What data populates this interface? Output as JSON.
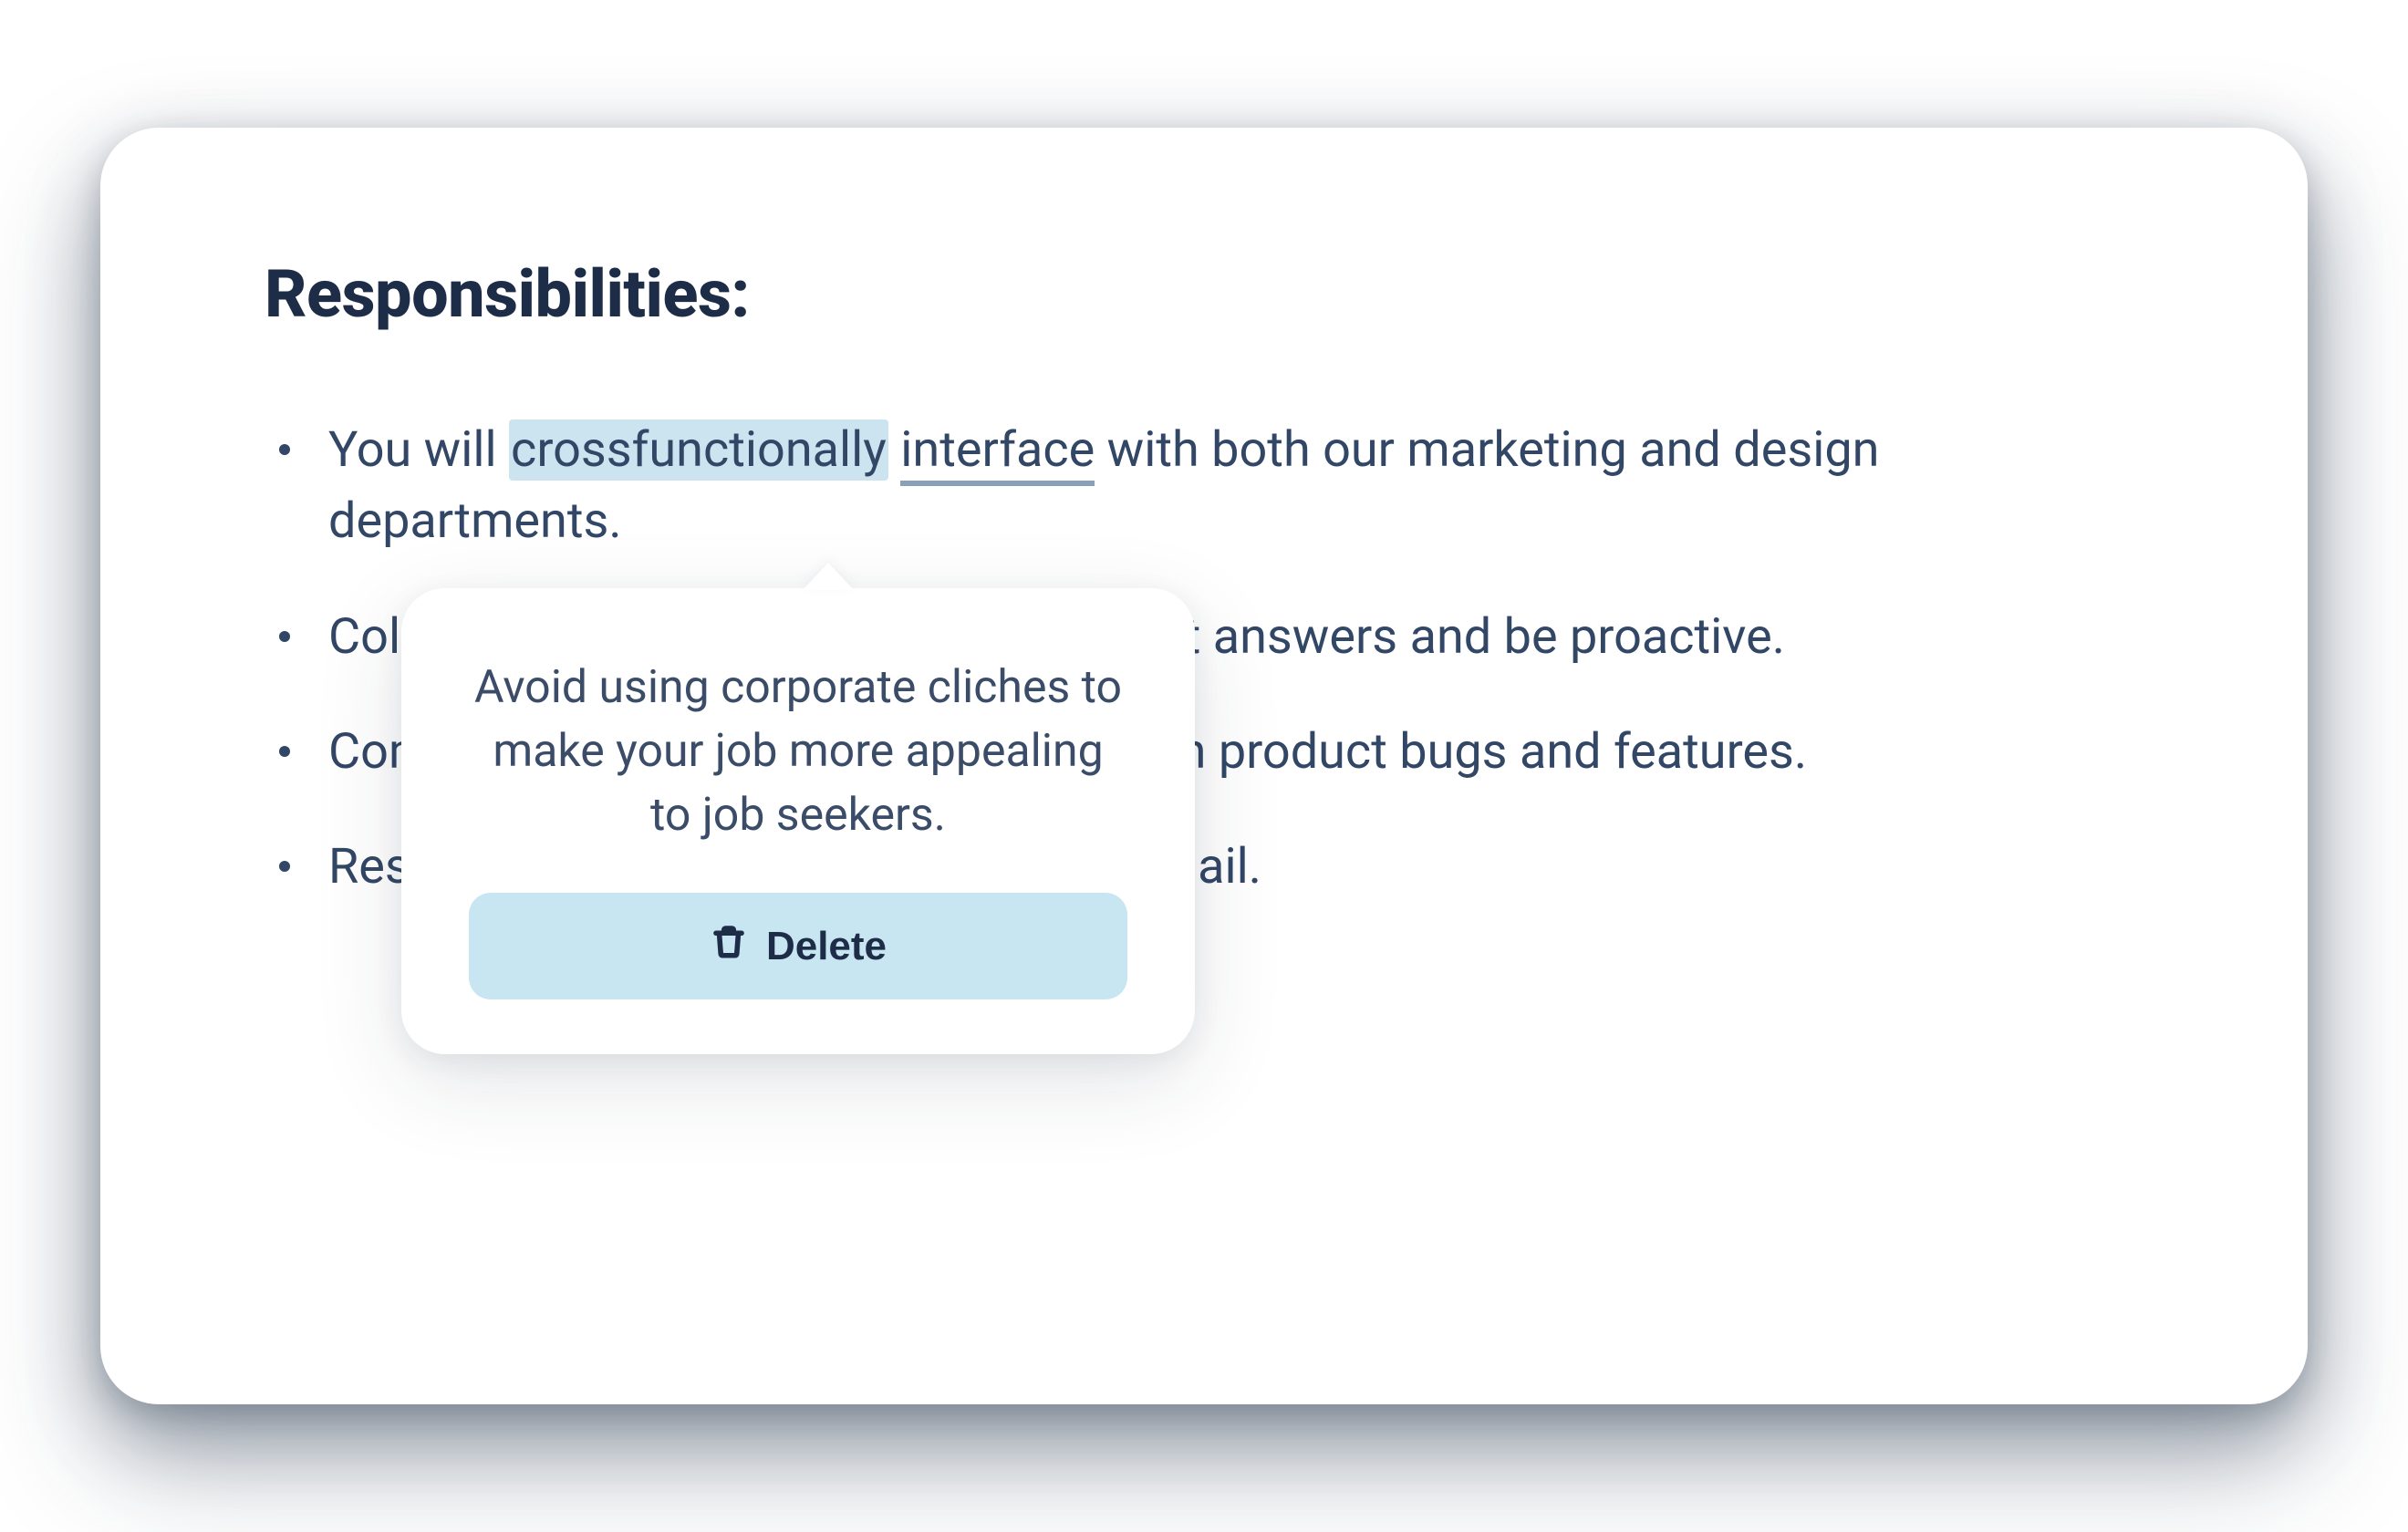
{
  "heading": "Responsibilities:",
  "bullets": [
    {
      "prefix": "You will ",
      "highlight": "crossfunctionally",
      "space": " ",
      "underline": "interface",
      "suffix": " with both our marketing and design departments."
    },
    {
      "text": "Collaborate with other teams to root out answers and be proactive."
    },
    {
      "text": "Communicate directly with engineers on product bugs and features."
    },
    {
      "text": "Respond to user inquiries via phone, email."
    }
  ],
  "popover": {
    "text": "Avoid using corporate cliches to make your job more appealing to job seekers.",
    "button": "Delete"
  }
}
